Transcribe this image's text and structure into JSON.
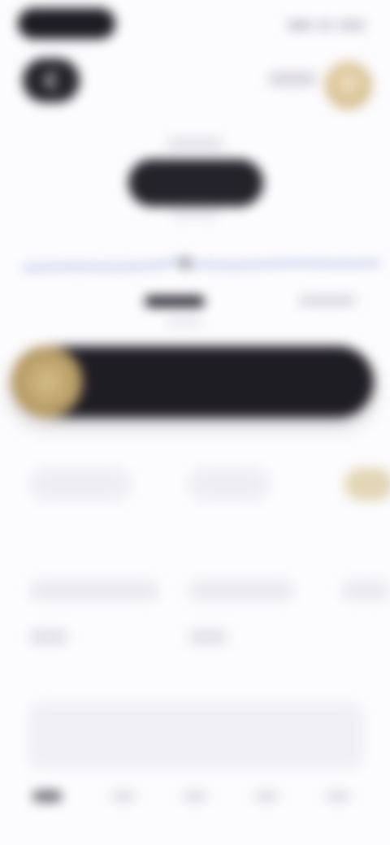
{
  "header": {
    "time": "",
    "link_label": ""
  },
  "price": {
    "caption": "",
    "value": "",
    "subcaption": ""
  },
  "swipe": {
    "label": ""
  },
  "sections": {
    "stats_title": "",
    "details_title": ""
  },
  "stats": [
    {
      "label": ""
    },
    {
      "label": ""
    },
    {
      "label": ""
    }
  ],
  "details": [
    {
      "label": "",
      "value": ""
    },
    {
      "label": "",
      "value": ""
    },
    {
      "label": "",
      "value": ""
    }
  ],
  "tabs": [
    {
      "label": ""
    },
    {
      "label": ""
    },
    {
      "label": ""
    },
    {
      "label": ""
    },
    {
      "label": ""
    }
  ],
  "icons": {
    "back": "chevron-left-icon",
    "avatar": "avatar",
    "swipe_knob": "coin-icon"
  },
  "colors": {
    "accent_dark": "#1f1d24",
    "accent_gold": "#c2a574",
    "line_blue": "#6f8fd6",
    "background": "#fcfbfd"
  }
}
